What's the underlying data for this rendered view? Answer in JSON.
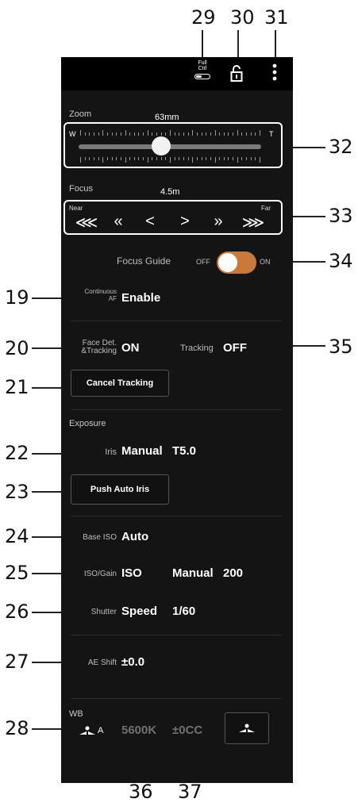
{
  "callouts": {
    "c29": "29",
    "c30": "30",
    "c31": "31",
    "c32": "32",
    "c33": "33",
    "c34": "34",
    "c35": "35",
    "c19": "19",
    "c20": "20",
    "c21": "21",
    "c22": "22",
    "c23": "23",
    "c24": "24",
    "c25": "25",
    "c26": "26",
    "c27": "27",
    "c28": "28",
    "c36": "36",
    "c37": "37"
  },
  "topbar": {
    "full_ctrl_line1": "Full",
    "full_ctrl_line2": "Ctrl",
    "lock_icon": "unlock-icon",
    "menu_icon": "kebab-menu-icon"
  },
  "zoom": {
    "label": "Zoom",
    "value": "63mm",
    "wide": "W",
    "tele": "T",
    "position": 0.45
  },
  "focus": {
    "label": "Focus",
    "value": "4.5m",
    "near": "Near",
    "far": "Far",
    "buttons": [
      "⋘",
      "«",
      "<",
      ">",
      "»",
      "⋙"
    ]
  },
  "focus_guide": {
    "label": "Focus Guide",
    "off": "OFF",
    "on": "ON",
    "state": "on"
  },
  "continuous_af": {
    "label_line1": "Continuous",
    "label_line2": "AF",
    "value": "Enable"
  },
  "face_detection": {
    "label_line1": "Face Det.",
    "label_line2": "&Tracking",
    "value": "ON"
  },
  "tracking": {
    "label": "Tracking",
    "value": "OFF",
    "cancel_button": "Cancel Tracking"
  },
  "exposure": {
    "section_label": "Exposure",
    "iris_label": "Iris",
    "iris_mode": "Manual",
    "iris_value": "T5.0",
    "push_auto_iris_button": "Push Auto Iris",
    "base_iso_label": "Base ISO",
    "base_iso_value": "Auto",
    "iso_gain_label": "ISO/Gain",
    "iso_gain_value": "ISO",
    "iso_mode": "Manual",
    "iso_value": "200",
    "shutter_label": "Shutter",
    "shutter_mode": "Speed",
    "shutter_value": "1/60",
    "ae_shift_label": "AE Shift",
    "ae_shift_value": "±0.0"
  },
  "wb": {
    "section_label": "WB",
    "mode_suffix": "A",
    "kelvin": "5600K",
    "cc": "±0CC"
  }
}
